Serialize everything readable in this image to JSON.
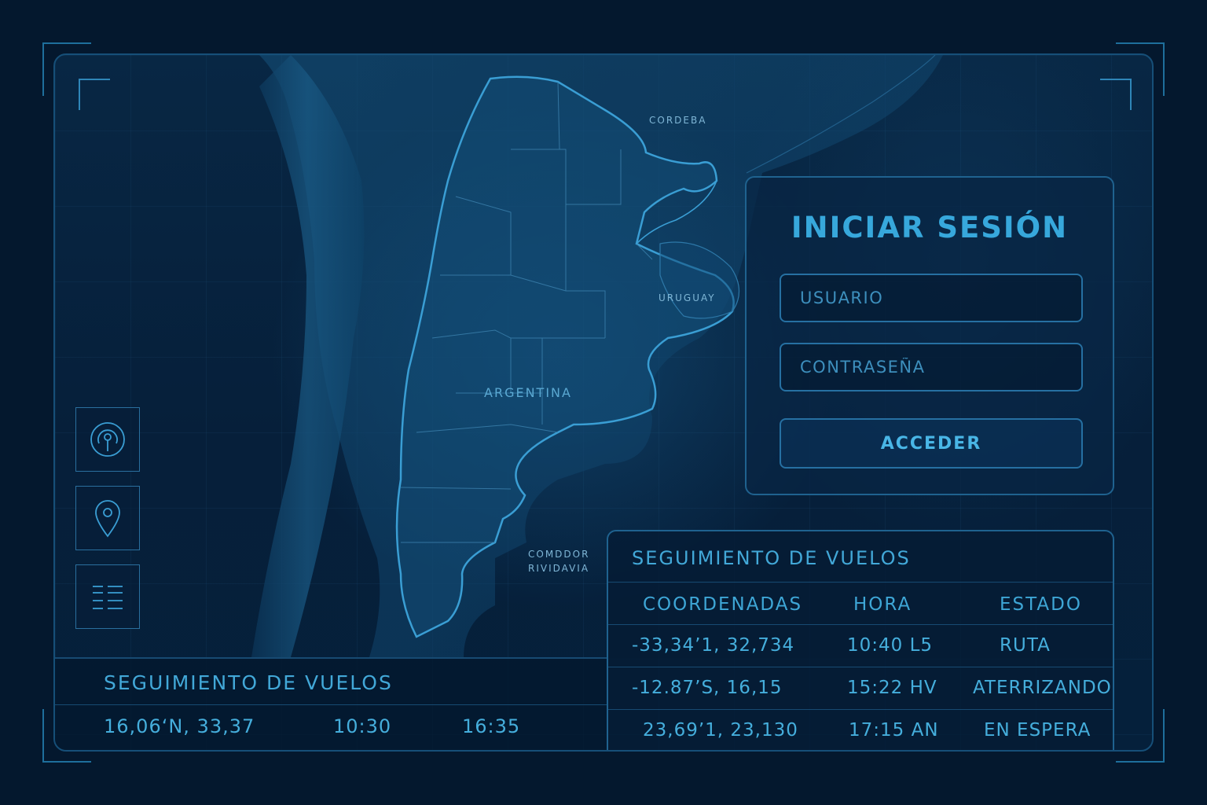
{
  "map": {
    "labels": {
      "cordoba": "CORDEBA",
      "uruguay": "URUGUAY",
      "argentina": "ARGENTINA",
      "comodoro_line1": "COMDDOR",
      "comodoro_line2": "RIVIDAVIA"
    }
  },
  "tools": {
    "icons": [
      "signal-icon",
      "location-pin-icon",
      "list-icon"
    ]
  },
  "login": {
    "title": "INICIAR SESIÓN",
    "username_placeholder": "USUARIO",
    "password_placeholder": "CONTRASEÑA",
    "submit_label": "ACCEDER"
  },
  "tracking_right": {
    "title": "SEGUIMIENTO DE VUELOS",
    "headers": [
      "COORDENADAS",
      "HORA",
      "ESTADO"
    ],
    "rows": [
      {
        "coords": "-33,34’1, 32,734",
        "time": "10:40 L5",
        "status": "RUTA"
      },
      {
        "coords": "-12.87’S, 16,15",
        "time": "15:22 HV",
        "status": "ATERRIZANDO"
      },
      {
        "coords": "23,69’1, 23,130",
        "time": "17:15 AN",
        "status": "EN ESPERA"
      }
    ]
  },
  "tracking_left": {
    "title": "SEGUIMIENTO DE VUELOS",
    "row": {
      "coords": "16,06‘N, 33,37",
      "time1": "10:30",
      "time2": "16:35"
    }
  },
  "colors": {
    "background": "#04182e",
    "accent": "#37a8dc",
    "border": "#1f628f"
  }
}
